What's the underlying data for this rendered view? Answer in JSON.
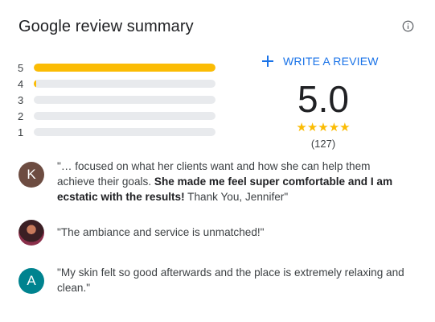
{
  "header": {
    "title": "Google review summary",
    "info_icon": "info-icon"
  },
  "distribution": [
    {
      "stars": "5",
      "fraction": 1.0
    },
    {
      "stars": "4",
      "fraction": 0.015
    },
    {
      "stars": "3",
      "fraction": 0.0
    },
    {
      "stars": "2",
      "fraction": 0.0
    },
    {
      "stars": "1",
      "fraction": 0.0
    }
  ],
  "write_review": {
    "label": "WRITE A REVIEW",
    "icon": "plus-icon"
  },
  "rating": {
    "average": "5.0",
    "stars": "★★★★★",
    "count": "(127)"
  },
  "reviews": [
    {
      "avatar_letter": "K",
      "text_pre": "\"… focused on what her clients want and how she can help them achieve their goals. ",
      "text_bold": "She made me feel super comfortable and I am ecstatic with the results!",
      "text_post": " Thank You, Jennifer\""
    },
    {
      "avatar_letter": "",
      "text_pre": "\"The ambiance and service is unmatched!\"",
      "text_bold": "",
      "text_post": ""
    },
    {
      "avatar_letter": "A",
      "text_pre": "\"My skin felt so good afterwards and the place is extremely relaxing and clean.\"",
      "text_bold": "",
      "text_post": ""
    }
  ],
  "colors": {
    "accent": "#1a73e8",
    "star": "#fbbc04",
    "track": "#e8eaed"
  }
}
